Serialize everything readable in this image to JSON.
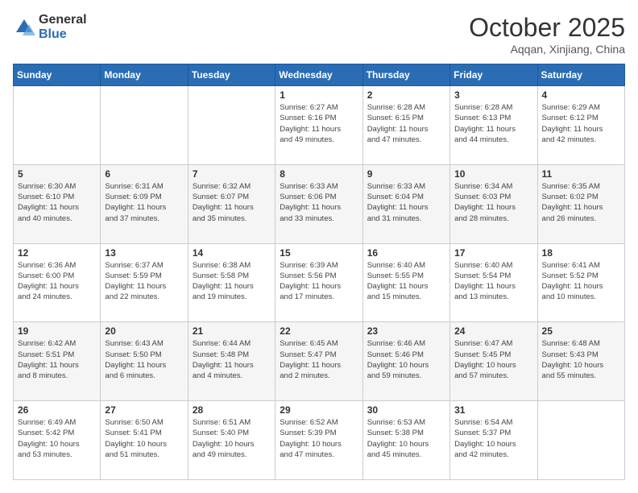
{
  "header": {
    "logo_line1": "General",
    "logo_line2": "Blue",
    "month": "October 2025",
    "location": "Aqqan, Xinjiang, China"
  },
  "days_of_week": [
    "Sunday",
    "Monday",
    "Tuesday",
    "Wednesday",
    "Thursday",
    "Friday",
    "Saturday"
  ],
  "weeks": [
    [
      {
        "day": "",
        "info": ""
      },
      {
        "day": "",
        "info": ""
      },
      {
        "day": "",
        "info": ""
      },
      {
        "day": "1",
        "info": "Sunrise: 6:27 AM\nSunset: 6:16 PM\nDaylight: 11 hours\nand 49 minutes."
      },
      {
        "day": "2",
        "info": "Sunrise: 6:28 AM\nSunset: 6:15 PM\nDaylight: 11 hours\nand 47 minutes."
      },
      {
        "day": "3",
        "info": "Sunrise: 6:28 AM\nSunset: 6:13 PM\nDaylight: 11 hours\nand 44 minutes."
      },
      {
        "day": "4",
        "info": "Sunrise: 6:29 AM\nSunset: 6:12 PM\nDaylight: 11 hours\nand 42 minutes."
      }
    ],
    [
      {
        "day": "5",
        "info": "Sunrise: 6:30 AM\nSunset: 6:10 PM\nDaylight: 11 hours\nand 40 minutes."
      },
      {
        "day": "6",
        "info": "Sunrise: 6:31 AM\nSunset: 6:09 PM\nDaylight: 11 hours\nand 37 minutes."
      },
      {
        "day": "7",
        "info": "Sunrise: 6:32 AM\nSunset: 6:07 PM\nDaylight: 11 hours\nand 35 minutes."
      },
      {
        "day": "8",
        "info": "Sunrise: 6:33 AM\nSunset: 6:06 PM\nDaylight: 11 hours\nand 33 minutes."
      },
      {
        "day": "9",
        "info": "Sunrise: 6:33 AM\nSunset: 6:04 PM\nDaylight: 11 hours\nand 31 minutes."
      },
      {
        "day": "10",
        "info": "Sunrise: 6:34 AM\nSunset: 6:03 PM\nDaylight: 11 hours\nand 28 minutes."
      },
      {
        "day": "11",
        "info": "Sunrise: 6:35 AM\nSunset: 6:02 PM\nDaylight: 11 hours\nand 26 minutes."
      }
    ],
    [
      {
        "day": "12",
        "info": "Sunrise: 6:36 AM\nSunset: 6:00 PM\nDaylight: 11 hours\nand 24 minutes."
      },
      {
        "day": "13",
        "info": "Sunrise: 6:37 AM\nSunset: 5:59 PM\nDaylight: 11 hours\nand 22 minutes."
      },
      {
        "day": "14",
        "info": "Sunrise: 6:38 AM\nSunset: 5:58 PM\nDaylight: 11 hours\nand 19 minutes."
      },
      {
        "day": "15",
        "info": "Sunrise: 6:39 AM\nSunset: 5:56 PM\nDaylight: 11 hours\nand 17 minutes."
      },
      {
        "day": "16",
        "info": "Sunrise: 6:40 AM\nSunset: 5:55 PM\nDaylight: 11 hours\nand 15 minutes."
      },
      {
        "day": "17",
        "info": "Sunrise: 6:40 AM\nSunset: 5:54 PM\nDaylight: 11 hours\nand 13 minutes."
      },
      {
        "day": "18",
        "info": "Sunrise: 6:41 AM\nSunset: 5:52 PM\nDaylight: 11 hours\nand 10 minutes."
      }
    ],
    [
      {
        "day": "19",
        "info": "Sunrise: 6:42 AM\nSunset: 5:51 PM\nDaylight: 11 hours\nand 8 minutes."
      },
      {
        "day": "20",
        "info": "Sunrise: 6:43 AM\nSunset: 5:50 PM\nDaylight: 11 hours\nand 6 minutes."
      },
      {
        "day": "21",
        "info": "Sunrise: 6:44 AM\nSunset: 5:48 PM\nDaylight: 11 hours\nand 4 minutes."
      },
      {
        "day": "22",
        "info": "Sunrise: 6:45 AM\nSunset: 5:47 PM\nDaylight: 11 hours\nand 2 minutes."
      },
      {
        "day": "23",
        "info": "Sunrise: 6:46 AM\nSunset: 5:46 PM\nDaylight: 10 hours\nand 59 minutes."
      },
      {
        "day": "24",
        "info": "Sunrise: 6:47 AM\nSunset: 5:45 PM\nDaylight: 10 hours\nand 57 minutes."
      },
      {
        "day": "25",
        "info": "Sunrise: 6:48 AM\nSunset: 5:43 PM\nDaylight: 10 hours\nand 55 minutes."
      }
    ],
    [
      {
        "day": "26",
        "info": "Sunrise: 6:49 AM\nSunset: 5:42 PM\nDaylight: 10 hours\nand 53 minutes."
      },
      {
        "day": "27",
        "info": "Sunrise: 6:50 AM\nSunset: 5:41 PM\nDaylight: 10 hours\nand 51 minutes."
      },
      {
        "day": "28",
        "info": "Sunrise: 6:51 AM\nSunset: 5:40 PM\nDaylight: 10 hours\nand 49 minutes."
      },
      {
        "day": "29",
        "info": "Sunrise: 6:52 AM\nSunset: 5:39 PM\nDaylight: 10 hours\nand 47 minutes."
      },
      {
        "day": "30",
        "info": "Sunrise: 6:53 AM\nSunset: 5:38 PM\nDaylight: 10 hours\nand 45 minutes."
      },
      {
        "day": "31",
        "info": "Sunrise: 6:54 AM\nSunset: 5:37 PM\nDaylight: 10 hours\nand 42 minutes."
      },
      {
        "day": "",
        "info": ""
      }
    ]
  ]
}
